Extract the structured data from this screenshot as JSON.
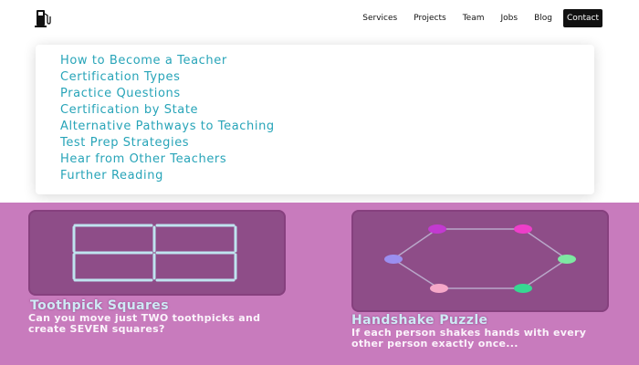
{
  "nav": {
    "logo_icon": "gas-pump-icon",
    "items": [
      "Services",
      "Projects",
      "Team",
      "Jobs",
      "Blog"
    ],
    "contact": "Contact"
  },
  "menu": {
    "items": [
      "How to Become a Teacher",
      "Certification Types",
      "Practice Questions",
      "Certification by State",
      "Alternative Pathways to Teaching",
      "Test Prep Strategies",
      "Hear from Other Teachers",
      "Further Reading"
    ],
    "highlighted_index": 0
  },
  "puzzles": [
    {
      "title": "Toothpick Squares",
      "description": "Can you move just TWO toothpicks and create SEVEN squares?"
    },
    {
      "title": "Handshake Puzzle",
      "description": "If each person shakes hands with every other person exactly once..."
    }
  ],
  "colors": {
    "menu_text": "#27a4b8",
    "band": "#c87bbd",
    "card": "#8e4d88",
    "contact_bg": "#111111"
  }
}
